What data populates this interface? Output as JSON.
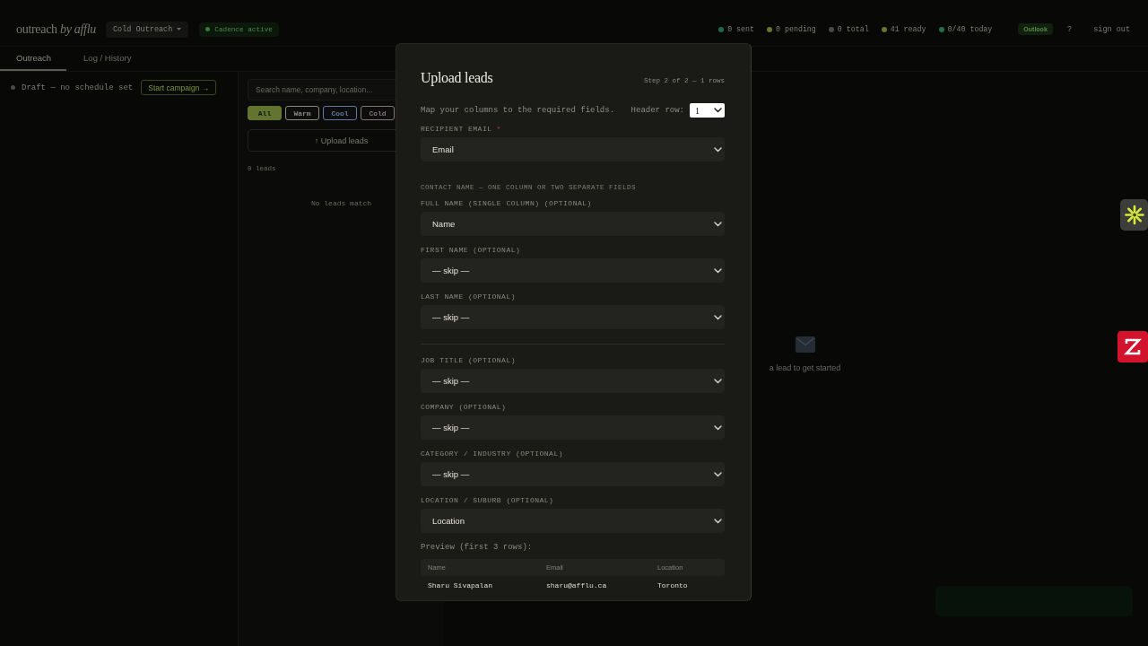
{
  "header": {
    "logo": "outreach *by afflu*",
    "campaign_menu": "Cold Outreach",
    "status_pill": "Cadence active",
    "stats": [
      {
        "label": "0 sent",
        "color": "#1d6a4c"
      },
      {
        "label": "0 pending",
        "color": "#6c7230"
      },
      {
        "label": "0 total",
        "color": "#4a4a4a"
      },
      {
        "label": "41 ready",
        "color": "#6c7230"
      },
      {
        "label": "0/40 today",
        "color": "#237044"
      }
    ],
    "account_badge": "Outlook",
    "help": "?",
    "sign_out": "sign out"
  },
  "tabs": [
    {
      "label": "Outreach",
      "selected": true
    },
    {
      "label": "Log / History",
      "selected": false
    }
  ],
  "campaign_bar": {
    "status": "Draft — no schedule set",
    "button": "Start campaign →"
  },
  "leads_panel": {
    "search": {
      "placeholder": "Search name, company, location..."
    },
    "filters": [
      {
        "label": "All",
        "selected": true,
        "color": "#62742f"
      },
      {
        "label": "Warm",
        "selected": false,
        "color": "#8a8a7e"
      },
      {
        "label": "Cool",
        "selected": false,
        "color": "#6478a8"
      },
      {
        "label": "Cold",
        "selected": false,
        "color": "#86727e"
      }
    ],
    "upload_button": "↑ Upload leads",
    "count": "0 leads",
    "empty": "No leads match"
  },
  "detail": {
    "empty": "a lead to get started"
  },
  "modal": {
    "title": "Upload leads",
    "step": "Step 2 of 2 — 1 rows",
    "instruction": "Map your columns to the required fields.",
    "header_row": {
      "label": "Header row:",
      "value": "1"
    },
    "items": [
      {
        "kind": "field",
        "label": "RECIPIENT EMAIL",
        "required_mark": "*",
        "value": "Email"
      },
      {
        "kind": "note",
        "text": "CONTACT NAME — ONE COLUMN OR TWO SEPARATE FIELDS"
      },
      {
        "kind": "field",
        "label": "FULL NAME (SINGLE COLUMN) (OPTIONAL)",
        "value": "Name"
      },
      {
        "kind": "field",
        "label": "FIRST NAME (OPTIONAL)",
        "value": "— skip —"
      },
      {
        "kind": "field",
        "label": "LAST NAME (OPTIONAL)",
        "value": "— skip —"
      },
      {
        "kind": "divider"
      },
      {
        "kind": "field",
        "label": "JOB TITLE (OPTIONAL)",
        "value": "— skip —"
      },
      {
        "kind": "field",
        "label": "COMPANY (OPTIONAL)",
        "value": "— skip —"
      },
      {
        "kind": "field",
        "label": "CATEGORY / INDUSTRY (OPTIONAL)",
        "value": "— skip —"
      },
      {
        "kind": "field",
        "label": "LOCATION / SUBURB (OPTIONAL)",
        "value": "Location"
      }
    ],
    "preview": {
      "title": "Preview (first 3 rows):",
      "columns": [
        "Name",
        "Email",
        "Location"
      ],
      "rows": [
        [
          "Sharu Sivapalan",
          "sharu@afflu.ca",
          "Toronto"
        ]
      ]
    }
  }
}
